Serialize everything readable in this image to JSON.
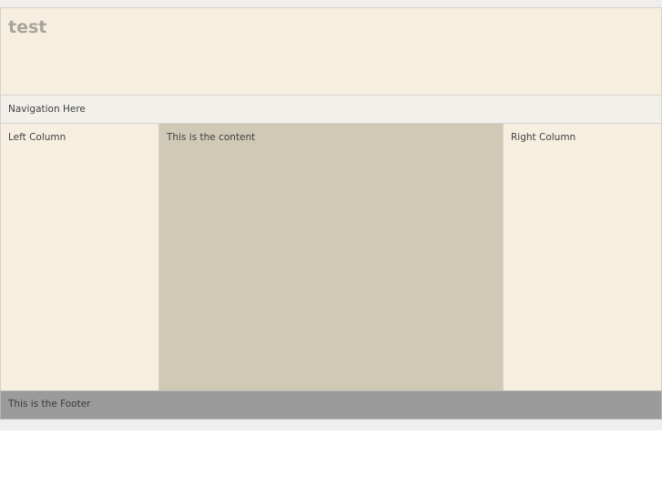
{
  "header": {
    "title": "test"
  },
  "nav": {
    "text": "Navigation Here"
  },
  "columns": {
    "left": "Left Column",
    "content": "This is the content",
    "right": "Right Column"
  },
  "footer": {
    "text": "This is the Footer"
  },
  "colors": {
    "header_bg": "#f6efe0",
    "nav_bg": "#f2f0ea",
    "content_bg": "#cfc9b6",
    "footer_bg": "#9b9b9b",
    "page_bg": "#efeeec"
  }
}
